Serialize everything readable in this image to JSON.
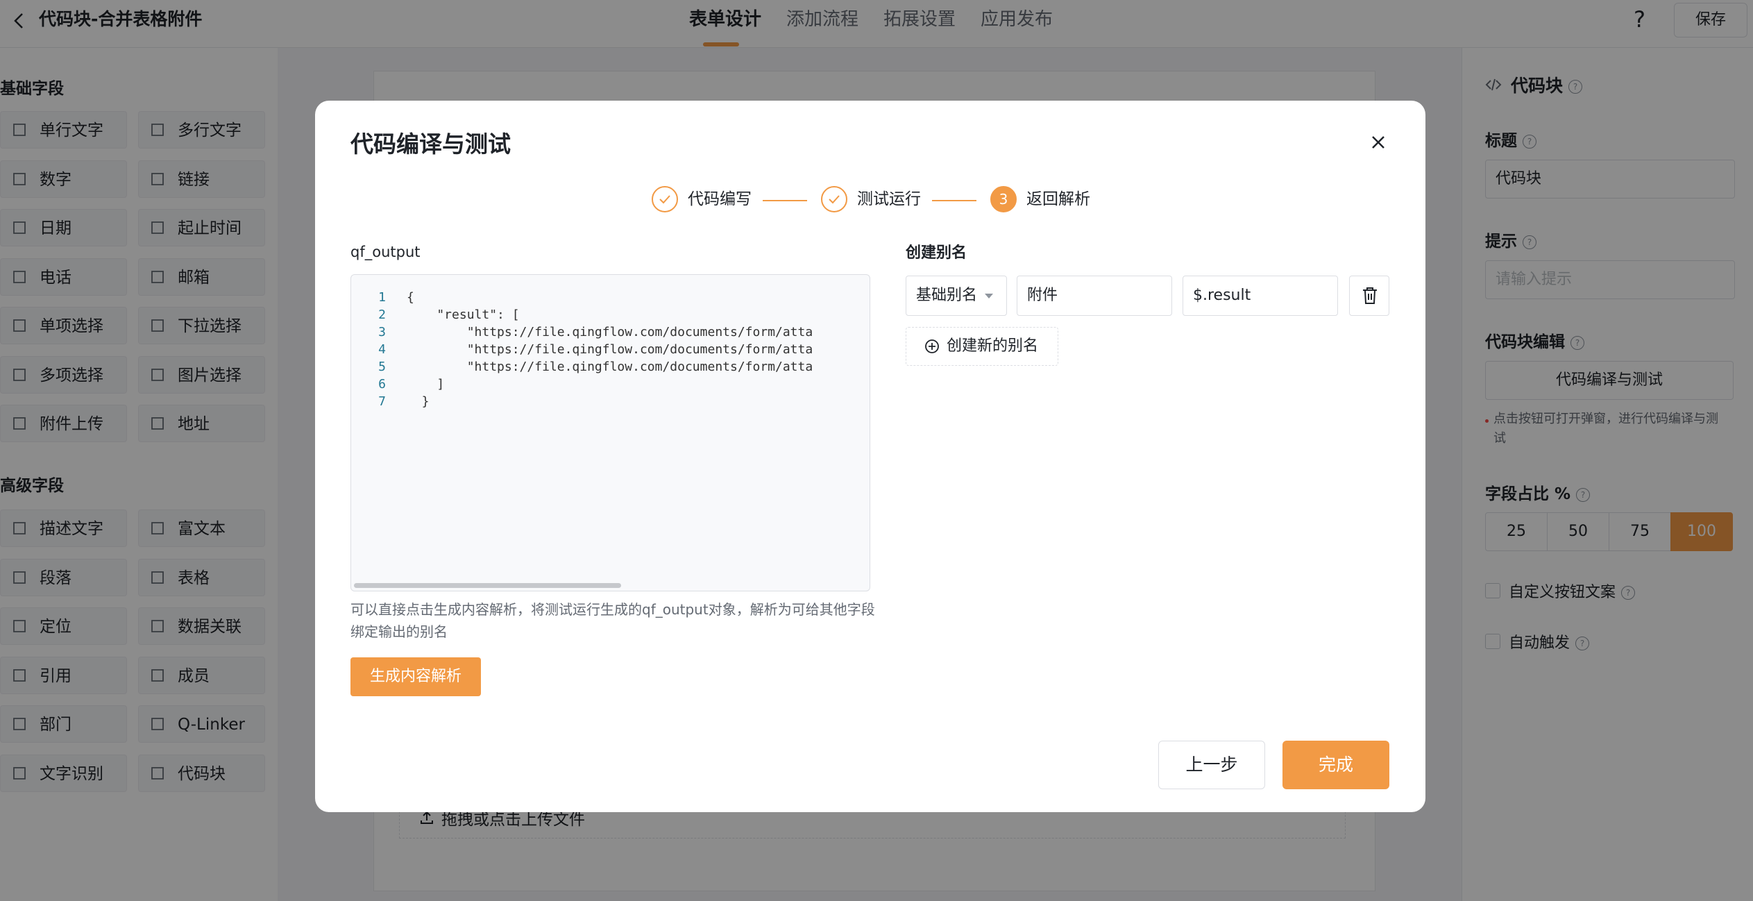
{
  "app": {
    "title": "代码块-合并表格附件",
    "save_label": "保存",
    "help_label": "?"
  },
  "nav": {
    "tabs": [
      {
        "label": "表单设计",
        "active": true
      },
      {
        "label": "添加流程",
        "active": false
      },
      {
        "label": "拓展设置",
        "active": false
      },
      {
        "label": "应用发布",
        "active": false
      }
    ]
  },
  "left_panel": {
    "basic_title": "基础字段",
    "basic_fields": [
      {
        "label": "单行文字",
        "icon": "single-line-text-icon"
      },
      {
        "label": "多行文字",
        "icon": "multi-line-text-icon"
      },
      {
        "label": "数字",
        "icon": "number-icon"
      },
      {
        "label": "链接",
        "icon": "link-icon"
      },
      {
        "label": "日期",
        "icon": "calendar-icon"
      },
      {
        "label": "起止时间",
        "icon": "time-range-icon"
      },
      {
        "label": "电话",
        "icon": "phone-icon"
      },
      {
        "label": "邮箱",
        "icon": "mail-icon"
      },
      {
        "label": "单项选择",
        "icon": "radio-icon"
      },
      {
        "label": "下拉选择",
        "icon": "dropdown-icon"
      },
      {
        "label": "多项选择",
        "icon": "checkbox-icon"
      },
      {
        "label": "图片选择",
        "icon": "image-icon"
      },
      {
        "label": "附件上传",
        "icon": "upload-icon"
      },
      {
        "label": "地址",
        "icon": "address-icon"
      }
    ],
    "advanced_title": "高级字段",
    "advanced_fields": [
      {
        "label": "描述文字",
        "icon": "description-icon"
      },
      {
        "label": "富文本",
        "icon": "rich-text-icon"
      },
      {
        "label": "段落",
        "icon": "paragraph-icon"
      },
      {
        "label": "表格",
        "icon": "table-icon"
      },
      {
        "label": "定位",
        "icon": "location-icon"
      },
      {
        "label": "数据关联",
        "icon": "data-link-icon"
      },
      {
        "label": "引用",
        "icon": "reference-icon"
      },
      {
        "label": "成员",
        "icon": "member-icon"
      },
      {
        "label": "部门",
        "icon": "department-icon"
      },
      {
        "label": "Q-Linker",
        "icon": "q-linker-icon"
      },
      {
        "label": "文字识别",
        "icon": "ocr-icon"
      },
      {
        "label": "代码块",
        "icon": "code-icon"
      }
    ]
  },
  "canvas": {
    "upload_text": "拖拽或点击上传文件"
  },
  "right_panel": {
    "header": "代码块",
    "title_label": "标题",
    "title_value": "代码块",
    "hint_label": "提示",
    "hint_placeholder": "请输入提示",
    "code_edit_label": "代码块编辑",
    "code_edit_button": "代码编译与测试",
    "code_edit_hint": "点击按钮可打开弹窗，进行代码编译与测试",
    "ratio_label": "字段占比 %",
    "ratio_options": [
      "25",
      "50",
      "75",
      "100"
    ],
    "ratio_selected": "100",
    "custom_button_label": "自定义按钮文案",
    "auto_trigger_label": "自动触发"
  },
  "modal": {
    "title": "代码编译与测试",
    "steps": [
      {
        "label": "代码编写",
        "state": "done"
      },
      {
        "label": "测试运行",
        "state": "done"
      },
      {
        "label": "返回解析",
        "state": "current",
        "number": "3"
      }
    ],
    "output_title": "qf_output",
    "code_lines": [
      {
        "n": "1",
        "text": "{"
      },
      {
        "n": "2",
        "text": "    \"result\": ["
      },
      {
        "n": "3",
        "text": "        \"https://file.qingflow.com/documents/form/atta"
      },
      {
        "n": "4",
        "text": "        \"https://file.qingflow.com/documents/form/atta"
      },
      {
        "n": "5",
        "text": "        \"https://file.qingflow.com/documents/form/atta"
      },
      {
        "n": "6",
        "text": "    ]"
      },
      {
        "n": "7",
        "text": "  }"
      }
    ],
    "description": "可以直接点击生成内容解析，将测试运行生成的qf_output对象，解析为可给其他字段绑定输出的别名",
    "generate_button": "生成内容解析",
    "alias_title": "创建别名",
    "alias_rows": [
      {
        "type": "基础别名",
        "name": "附件",
        "path": "$.result"
      }
    ],
    "add_alias_button": "创建新的别名",
    "prev_button": "上一步",
    "done_button": "完成"
  },
  "colors": {
    "accent": "#f29a45",
    "overlay": "rgba(0,0,0,0.45)"
  }
}
